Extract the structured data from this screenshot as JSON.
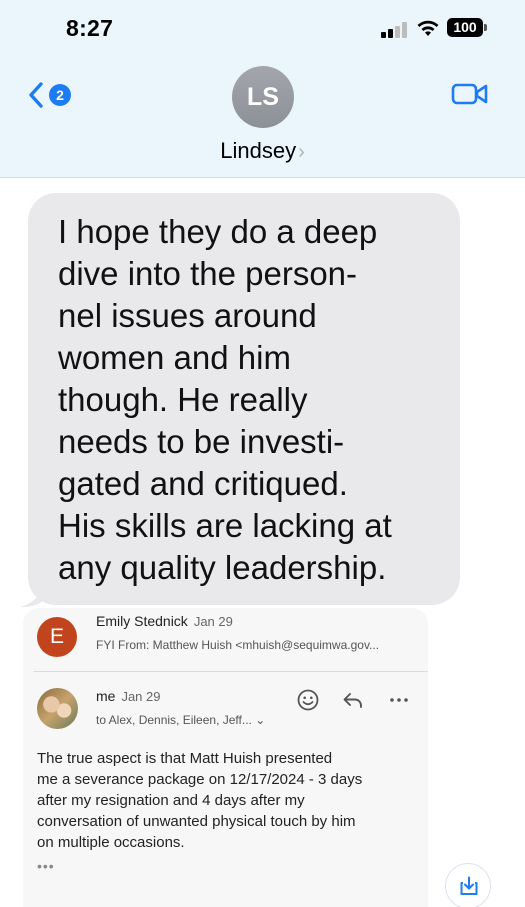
{
  "status_bar": {
    "time": "8:27",
    "battery": "100",
    "icons": [
      "cellular-signal-icon",
      "wifi-icon",
      "battery-icon"
    ]
  },
  "nav": {
    "back_badge": "2",
    "contact_initials": "LS",
    "contact_name": "Lindsey",
    "chevron": "›",
    "video_icon": "video-camera-icon"
  },
  "message": {
    "text": "I hope they do a deep\ndive into the person-\nnel issues around\nwomen and him\nthough. He really\nneeds to be investi-\ngated and critiqued.\nHis skills are lacking at\nany quality leadership."
  },
  "email": {
    "first": {
      "avatar_letter": "E",
      "sender": "Emily Stednick",
      "date": "Jan 29",
      "preview": "FYI From: Matthew Huish <mhuish@sequimwa.gov..."
    },
    "second": {
      "sender": "me",
      "date": "Jan 29",
      "recipients": "to Alex, Dennis, Eileen, Jeff... ⌄",
      "body": "The true aspect is that Matt Huish presented\nme a severance package on 12/17/2024 - 3 days\nafter my resignation and 4 days after my\nconversation of unwanted physical touch by him\non multiple occasions.",
      "more": "•••"
    }
  },
  "colors": {
    "header_bg": "#eaf6fb",
    "accent_blue": "#1e7cf2",
    "bubble_bg": "#e9e9eb",
    "email_avatar": "#c2441f"
  }
}
